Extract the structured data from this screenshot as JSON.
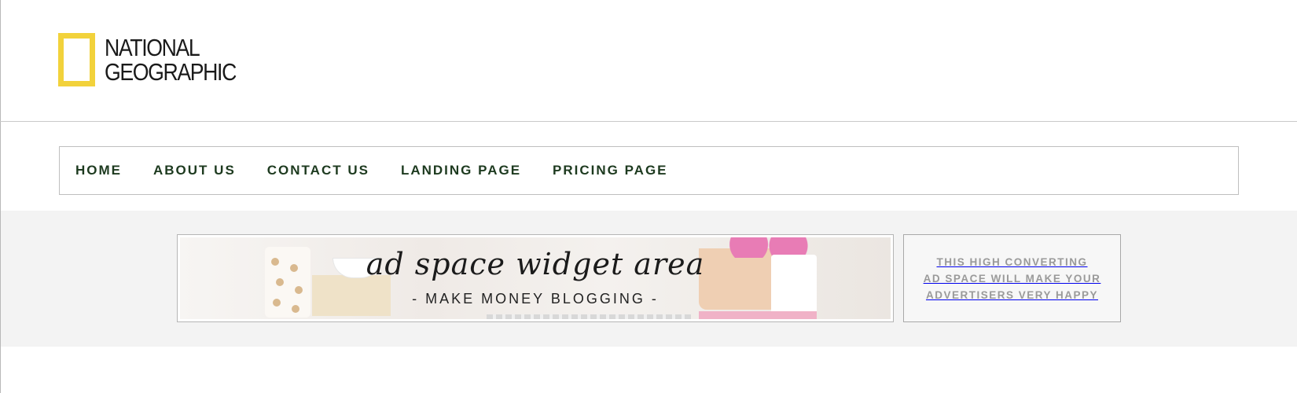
{
  "brand": {
    "logo_line1": "NATIONAL",
    "logo_line2": "GEOGRAPHIC",
    "logo_color": "#f2d23b"
  },
  "nav": {
    "items": [
      {
        "label": "HOME"
      },
      {
        "label": "ABOUT US"
      },
      {
        "label": "CONTACT US"
      },
      {
        "label": "LANDING PAGE"
      },
      {
        "label": "PRICING PAGE"
      }
    ],
    "text_color": "#1d3a1f"
  },
  "ads": {
    "main_banner": {
      "title": "ad space widget area",
      "subtitle": "- MAKE MONEY BLOGGING -"
    },
    "side_banner": {
      "line1": "THIS HIGH CONVERTING",
      "line2": "AD SPACE WILL MAKE YOUR",
      "line3": "ADVERTISERS VERY HAPPY"
    },
    "band_color": "#f3f3f3"
  }
}
